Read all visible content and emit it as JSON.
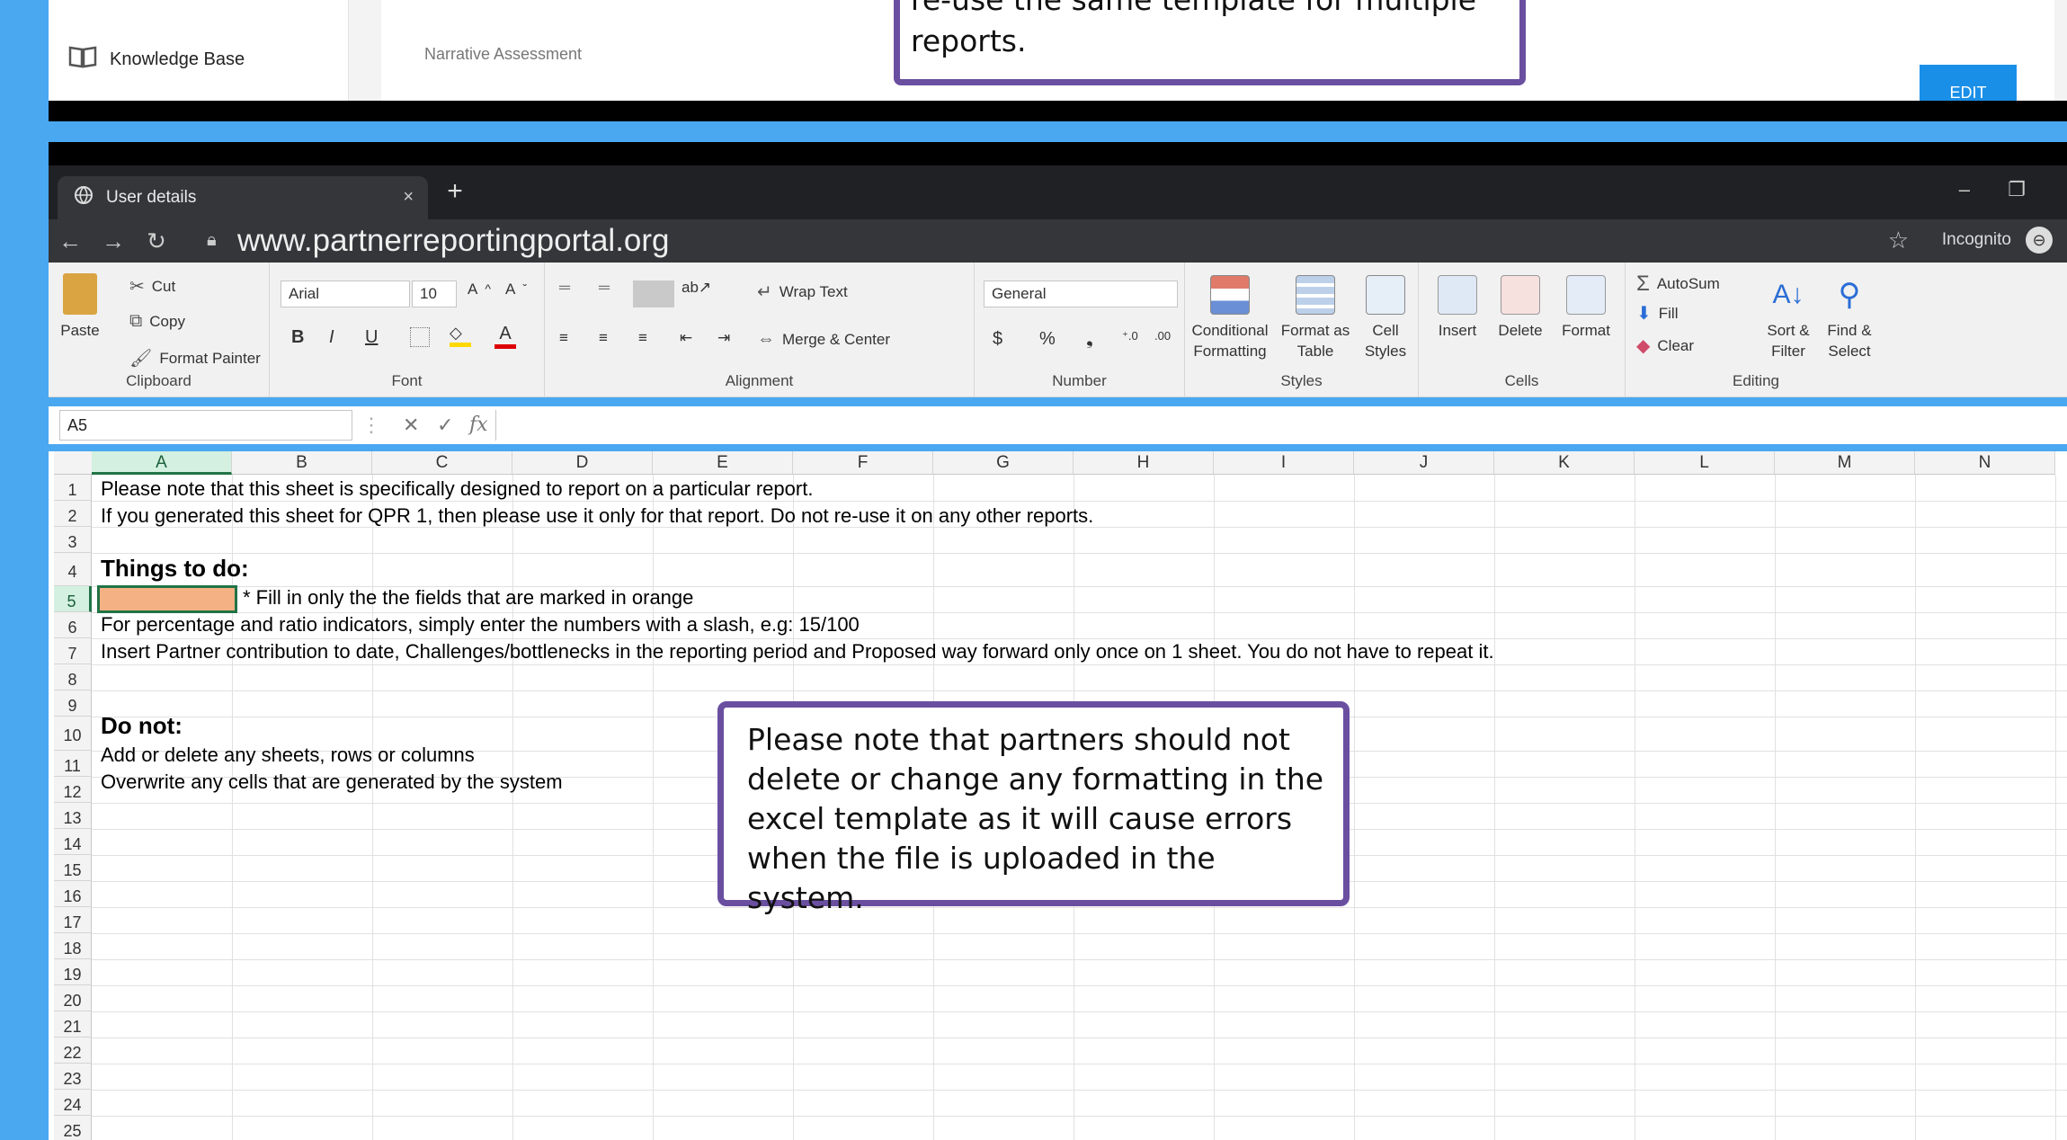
{
  "portal": {
    "sidebar_item": "Knowledge Base",
    "section_label": "Narrative Assessment",
    "edit_button": "EDIT",
    "callout_lines": [
      "re-use the same template for multiple",
      "reports."
    ]
  },
  "browser": {
    "tab_title": "User details",
    "tab_close": "×",
    "new_tab": "+",
    "url": "www.partnerreportingportal.org",
    "incognito_label": "Incognito",
    "minimize": "–",
    "restore": "❐"
  },
  "ribbon": {
    "clipboard": {
      "paste": "Paste",
      "cut": "Cut",
      "copy": "Copy",
      "format_painter": "Format Painter",
      "label": "Clipboard"
    },
    "font": {
      "name": "Arial",
      "size": "10",
      "label": "Font",
      "bold": "B",
      "italic": "I",
      "underline": "U"
    },
    "alignment": {
      "wrap_text": "Wrap Text",
      "merge_center": "Merge & Center",
      "label": "Alignment"
    },
    "number": {
      "format": "General",
      "label": "Number",
      "currency": "$",
      "percent": "%",
      "comma": "❟",
      "inc": "⁺.0",
      "dec": ".00"
    },
    "styles": {
      "conditional_1": "Conditional",
      "conditional_2": "Formatting",
      "format_table_1": "Format as",
      "format_table_2": "Table",
      "cell_styles_1": "Cell",
      "cell_styles_2": "Styles",
      "label": "Styles"
    },
    "cells": {
      "insert": "Insert",
      "delete": "Delete",
      "format": "Format",
      "label": "Cells"
    },
    "editing": {
      "autosum": "AutoSum",
      "fill": "Fill",
      "clear": "Clear",
      "sort_1": "Sort &",
      "sort_2": "Filter",
      "find_1": "Find &",
      "find_2": "Select",
      "label": "Editing"
    }
  },
  "formula_bar": {
    "name_box": "A5",
    "fx": "fx",
    "cancel": "✕",
    "enter": "✓"
  },
  "columns": [
    "A",
    "B",
    "C",
    "D",
    "E",
    "F",
    "G",
    "H",
    "I",
    "J",
    "K",
    "L",
    "M",
    "N"
  ],
  "rows": [
    "1",
    "2",
    "3",
    "4",
    "5",
    "6",
    "7",
    "8",
    "9",
    "10",
    "11",
    "12",
    "13",
    "14",
    "15",
    "16",
    "17",
    "18",
    "19",
    "20",
    "21",
    "22",
    "23",
    "24",
    "25"
  ],
  "cells": {
    "r1": "Please note that this sheet is specifically designed to report on a particular report.",
    "r2": "If you generated this sheet for QPR 1, then please use it only for that report. Do not re-use it on any other reports.",
    "r4": "Things to do:",
    "r5": "* Fill in only the the fields that are marked in orange",
    "r6": "For percentage and ratio indicators, simply enter the numbers with a slash, e.g: 15/100",
    "r7": "Insert Partner contribution to date, Challenges/bottlenecks in the reporting period and Proposed way forward only once on 1 sheet. You do not have to repeat it.",
    "r10": "Do not:",
    "r11": "Add or delete any sheets, rows or columns",
    "r12": "Overwrite any cells that are generated by the system"
  },
  "callout": {
    "lines": [
      "Please note that partners should not",
      "delete or change any formatting in the",
      "excel template as it will cause errors",
      "when the file is uploaded in the system."
    ]
  },
  "colors": {
    "border_purple": "#6a4fa0",
    "highlight_orange": "#f4b183",
    "excel_green": "#217346",
    "background_blue": "#4aa8f0"
  }
}
